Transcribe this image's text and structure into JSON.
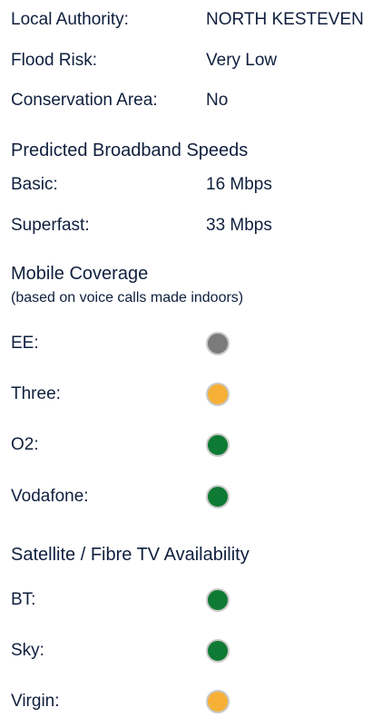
{
  "property": {
    "local_authority": {
      "label": "Local Authority:",
      "value": "NORTH KESTEVEN"
    },
    "flood_risk": {
      "label": "Flood Risk:",
      "value": "Very Low"
    },
    "conservation_area": {
      "label": "Conservation Area:",
      "value": "No"
    }
  },
  "broadband": {
    "heading": "Predicted Broadband Speeds",
    "basic": {
      "label": "Basic:",
      "value": "16 Mbps"
    },
    "superfast": {
      "label": "Superfast:",
      "value": "33 Mbps"
    }
  },
  "mobile": {
    "heading": "Mobile Coverage",
    "subheading": "(based on voice calls made indoors)",
    "items": [
      {
        "label": "EE:",
        "status": "grey",
        "color": "#7b7b7b"
      },
      {
        "label": "Three:",
        "status": "amber",
        "color": "#f5b035"
      },
      {
        "label": "O2:",
        "status": "green",
        "color": "#0f7a33"
      },
      {
        "label": "Vodafone:",
        "status": "green",
        "color": "#0f7a33"
      }
    ]
  },
  "tv": {
    "heading": "Satellite / Fibre TV Availability",
    "items": [
      {
        "label": "BT:",
        "status": "green",
        "color": "#0f7a33"
      },
      {
        "label": "Sky:",
        "status": "green",
        "color": "#0f7a33"
      },
      {
        "label": "Virgin:",
        "status": "amber",
        "color": "#f5b035"
      }
    ]
  }
}
